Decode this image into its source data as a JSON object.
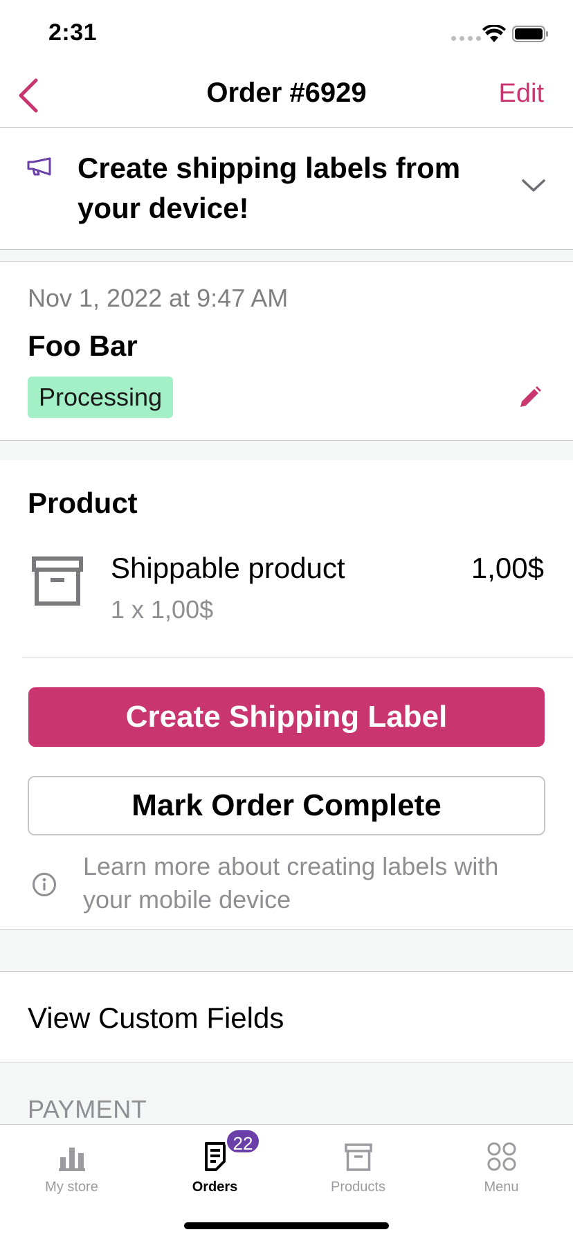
{
  "status_bar": {
    "time": "2:31"
  },
  "nav": {
    "title": "Order #6929",
    "edit_label": "Edit"
  },
  "banner": {
    "text": "Create shipping labels from your device!"
  },
  "order": {
    "date": "Nov 1, 2022 at 9:47 AM",
    "customer_name": "Foo Bar",
    "status": "Processing"
  },
  "product_section": {
    "title": "Product",
    "item": {
      "name": "Shippable product",
      "quantity_line": "1 x 1,00$",
      "price": "1,00$"
    },
    "create_label_button": "Create Shipping Label",
    "mark_complete_button": "Mark Order Complete",
    "info_text": "Learn more about creating labels with your mobile device"
  },
  "custom_fields": {
    "label": "View Custom Fields"
  },
  "payment": {
    "header": "PAYMENT"
  },
  "tabbar": {
    "items": [
      {
        "label": "My store",
        "icon": "bar-chart-icon"
      },
      {
        "label": "Orders",
        "icon": "orders-icon",
        "badge": "22"
      },
      {
        "label": "Products",
        "icon": "box-icon"
      },
      {
        "label": "Menu",
        "icon": "menu-grid-icon"
      }
    ]
  },
  "colors": {
    "accent": "#c9356e",
    "status_processing_bg": "#a3f0c6",
    "badge_bg": "#6b3fa8",
    "banner_icon": "#6b3fa8"
  }
}
